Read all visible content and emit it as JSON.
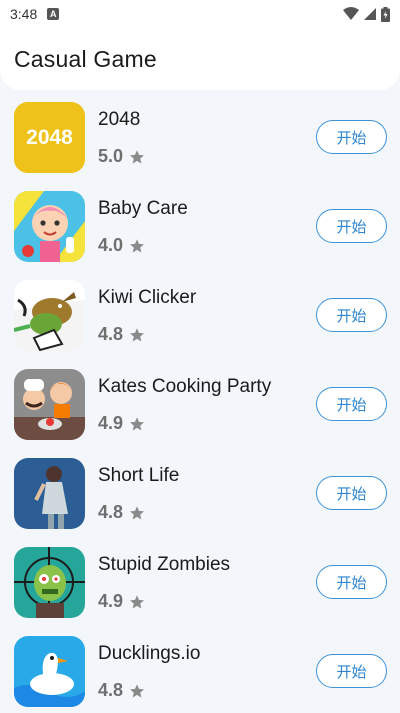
{
  "status": {
    "time": "3:48",
    "notif_icon": "a-badge-icon"
  },
  "header": {
    "title": "Casual Game"
  },
  "games": [
    {
      "name": "2048",
      "rating": "5.0",
      "button": "开始",
      "icon": "2048-icon",
      "icon_text": "2048"
    },
    {
      "name": "Baby Care",
      "rating": "4.0",
      "button": "开始",
      "icon": "baby-care-icon"
    },
    {
      "name": "Kiwi Clicker",
      "rating": "4.8",
      "button": "开始",
      "icon": "kiwi-clicker-icon"
    },
    {
      "name": "Kates Cooking Party",
      "rating": "4.9",
      "button": "开始",
      "icon": "kates-cooking-party-icon"
    },
    {
      "name": "Short Life",
      "rating": "4.8",
      "button": "开始",
      "icon": "short-life-icon"
    },
    {
      "name": "Stupid Zombies",
      "rating": "4.9",
      "button": "开始",
      "icon": "stupid-zombies-icon"
    },
    {
      "name": "Ducklings.io",
      "rating": "4.8",
      "button": "开始",
      "icon": "ducklings-io-icon"
    }
  ],
  "colors": {
    "accent": "#3c93d8",
    "background": "#f3f7fb",
    "star": "#8a8a8a"
  }
}
